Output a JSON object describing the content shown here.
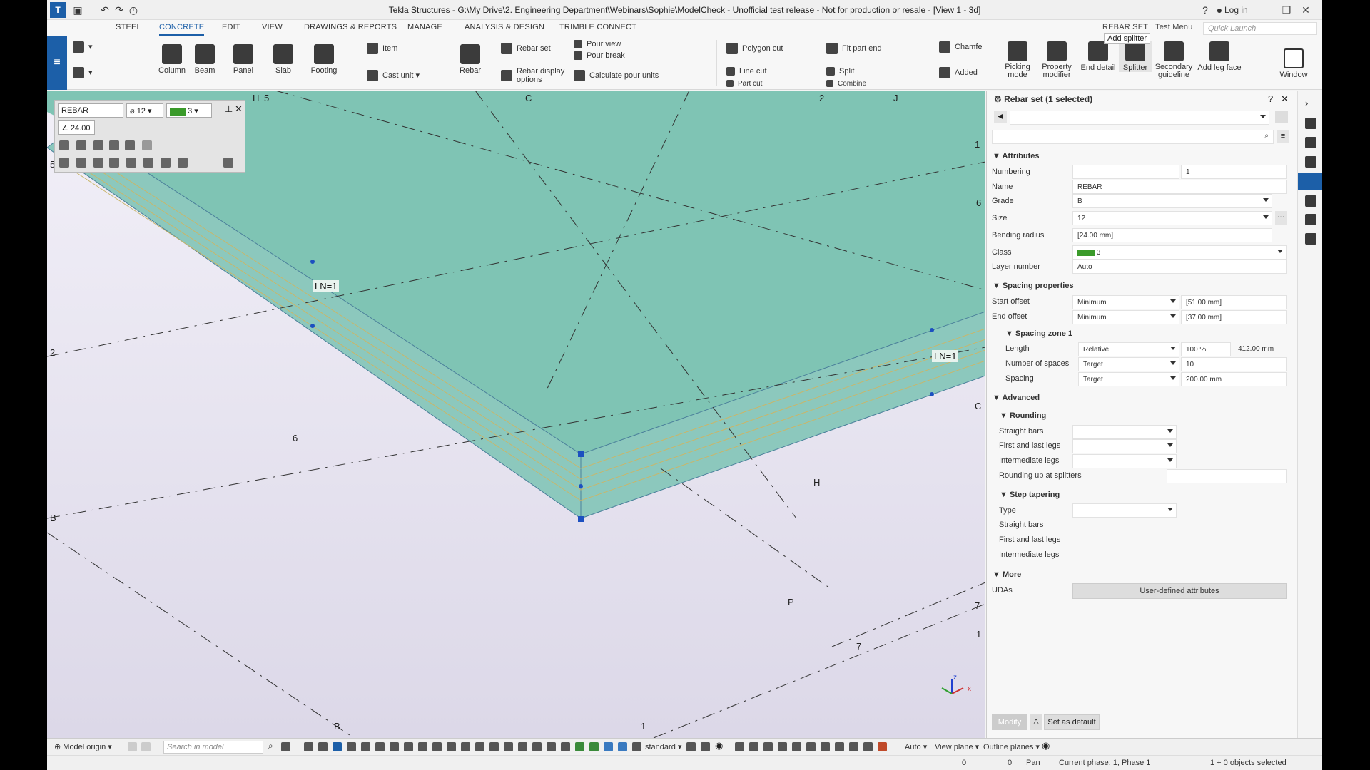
{
  "window": {
    "title": "Tekla Structures - G:\\My Drive\\2. Engineering Department\\Webinars\\Sophie\\ModelCheck - Unofficial test release - Not for production or resale - [View 1 - 3d]",
    "login": "Log in"
  },
  "tabs": [
    "STEEL",
    "CONCRETE",
    "EDIT",
    "VIEW",
    "DRAWINGS & REPORTS",
    "MANAGE",
    "ANALYSIS & DESIGN",
    "TRIMBLE CONNECT"
  ],
  "active_tab": "CONCRETE",
  "context_tabs": [
    "REBAR SET",
    "Test Menu"
  ],
  "quick_launch_placeholder": "Quick Launch",
  "ribbon": {
    "large": [
      "Column",
      "Beam",
      "Panel",
      "Slab",
      "Footing",
      "Rebar",
      "Picking mode",
      "Property modifier",
      "End detail",
      "Splitter",
      "Secondary guideline",
      "Add leg face",
      "Window"
    ],
    "small": [
      "Item",
      "Cast unit",
      "Rebar set",
      "Rebar display options",
      "Pour view",
      "Pour break",
      "Calculate pour units",
      "Polygon cut",
      "Line cut",
      "Part cut",
      "Fit part end",
      "Split",
      "Combine",
      "Chamfe",
      "Added"
    ]
  },
  "tooltip": "Add splitter",
  "mini_toolbar": {
    "name": "REBAR",
    "size": "12",
    "class": "3",
    "radius": "24.00",
    "class_color": "#3a9a2a"
  },
  "viewport": {
    "grid_labels": [
      "H",
      "5",
      "C",
      "2",
      "J",
      "1",
      "6",
      "2",
      "6",
      "C",
      "H",
      "B",
      "P",
      "7",
      "1",
      "7",
      "B",
      "1",
      "5"
    ],
    "ln_labels": [
      "LN=1",
      "LN=1"
    ],
    "slab_color": "#7fc4b4",
    "axis_labels": [
      "z",
      "x"
    ]
  },
  "panel": {
    "title": "Rebar set (1 selected)",
    "sections": {
      "attributes": "Attributes",
      "spacing": "Spacing properties",
      "zone": "Spacing zone 1",
      "advanced": "Advanced",
      "rounding": "Rounding",
      "tapering": "Step tapering",
      "more": "More"
    },
    "fields": {
      "numbering_label": "Numbering",
      "numbering_value": "1",
      "name_label": "Name",
      "name_value": "REBAR",
      "grade_label": "Grade",
      "grade_value": "B",
      "size_label": "Size",
      "size_value": "12",
      "bending_label": "Bending radius",
      "bending_value": "[24.00 mm]",
      "class_label": "Class",
      "class_value": "3",
      "layer_label": "Layer number",
      "layer_value": "Auto",
      "start_offset_label": "Start offset",
      "start_offset_mode": "Minimum",
      "start_offset_value": "[51.00 mm]",
      "end_offset_label": "End offset",
      "end_offset_mode": "Minimum",
      "end_offset_value": "[37.00 mm]",
      "length_label": "Length",
      "length_mode": "Relative",
      "length_pct": "100 %",
      "length_value": "412.00 mm",
      "nspaces_label": "Number of spaces",
      "nspaces_mode": "Target",
      "nspaces_value": "10",
      "spacing_label": "Spacing",
      "spacing_mode": "Target",
      "spacing_value": "200.00 mm",
      "straight_label": "Straight bars",
      "firstlast_label": "First and last legs",
      "inter_label": "Intermediate legs",
      "roundup_label": "Rounding up at splitters",
      "type_label": "Type",
      "t_straight_label": "Straight bars",
      "t_firstlast_label": "First and last legs",
      "t_inter_label": "Intermediate legs",
      "udas_label": "UDAs"
    },
    "uda_button": "User-defined attributes",
    "modify_button": "Modify",
    "set_default_button": "Set as default"
  },
  "bottom_toolbar": {
    "model_origin": "Model origin",
    "search_placeholder": "Search in model",
    "standard": "standard",
    "auto": "Auto",
    "view_plane": "View plane",
    "outline_planes": "Outline planes"
  },
  "status": {
    "x": "0",
    "y": "0",
    "mode": "Pan",
    "phase": "Current phase: 1, Phase 1",
    "selected": "1 + 0 objects selected"
  }
}
